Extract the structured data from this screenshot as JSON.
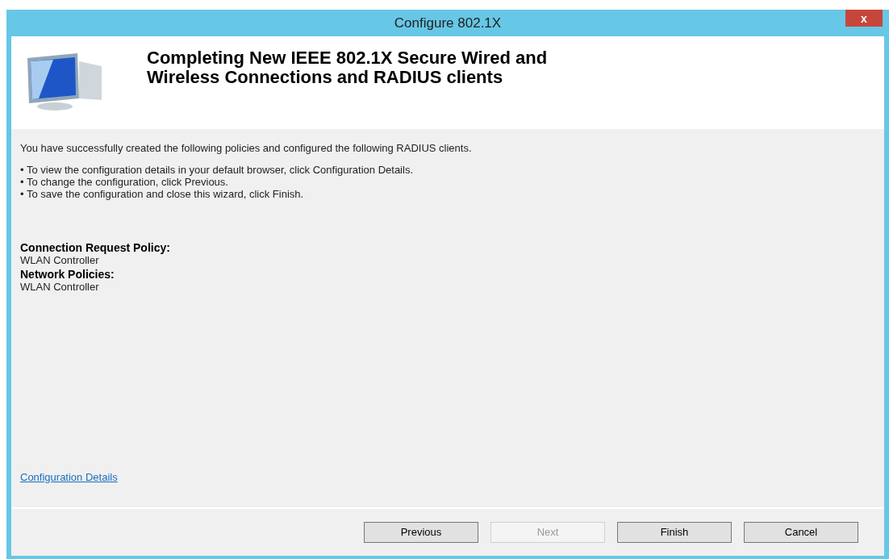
{
  "window": {
    "title": "Configure 802.1X",
    "close": "x"
  },
  "header": {
    "title": "Completing New IEEE 802.1X Secure Wired and Wireless Connections and RADIUS clients"
  },
  "intro": "You have successfully created the following policies and configured the following RADIUS clients.",
  "bullets": [
    "• To view the configuration details in your default browser, click Configuration Details.",
    "• To change the configuration, click Previous.",
    "• To save the configuration and close this wizard, click Finish."
  ],
  "sections": [
    {
      "label": "Connection Request Policy:",
      "value": "WLAN Controller"
    },
    {
      "label": "Network Policies:",
      "value": "WLAN Controller"
    }
  ],
  "link": "Configuration Details",
  "buttons": [
    {
      "label": "Previous",
      "disabled": false
    },
    {
      "label": "Next",
      "disabled": true
    },
    {
      "label": "Finish",
      "disabled": false
    },
    {
      "label": "Cancel",
      "disabled": false
    }
  ]
}
